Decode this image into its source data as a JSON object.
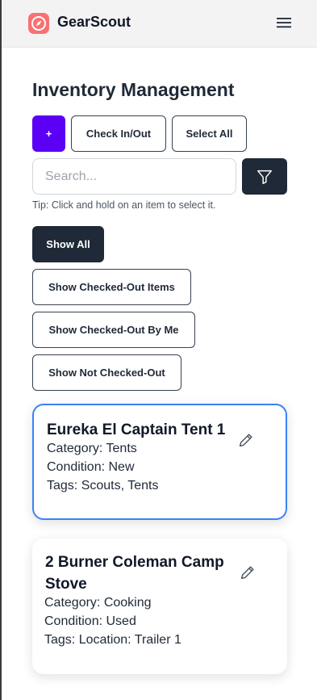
{
  "app": {
    "brand": "GearScout",
    "logo_icon": "compass-icon",
    "menu_icon": "hamburger-menu-icon"
  },
  "page": {
    "title": "Inventory Management"
  },
  "toolbar": {
    "add_label": "+",
    "check_label": "Check In/Out",
    "select_all_label": "Select All",
    "accent_color": "#5b00f5"
  },
  "search": {
    "placeholder": "Search...",
    "value": "",
    "filter_icon": "filter-icon"
  },
  "tip": "Tip: Click and hold on an item to select it.",
  "filters": {
    "show_all": "Show All",
    "checked_out": "Show Checked-Out Items",
    "checked_out_by_me": "Show Checked-Out By Me",
    "not_checked_out": "Show Not Checked-Out",
    "active": "Show All"
  },
  "items": [
    {
      "name": "Eureka El Captain Tent 1",
      "category": "Category: Tents",
      "condition": "Condition: New",
      "tags": "Tags: Scouts, Tents",
      "selected": true
    },
    {
      "name": "2 Burner Coleman Camp Stove",
      "category": "Category: Cooking",
      "condition": "Condition: Used",
      "tags": "Tags: Location: Trailer 1",
      "selected": false
    }
  ]
}
